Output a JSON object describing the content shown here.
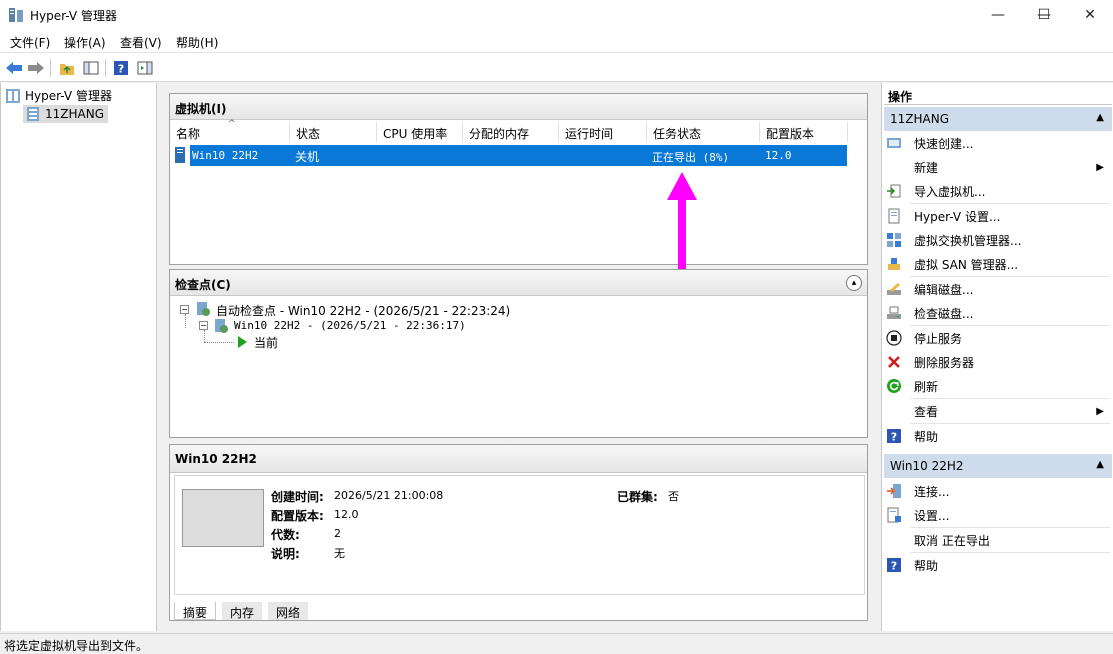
{
  "window": {
    "title": "Hyper-V 管理器",
    "controls": {
      "minimize": "—",
      "maximize": "☐",
      "close": "✕"
    }
  },
  "menu": [
    "文件(F)",
    "操作(A)",
    "查看(V)",
    "帮助(H)"
  ],
  "tree": {
    "root": "Hyper-V 管理器",
    "server": "11ZHANG"
  },
  "vms_panel": {
    "title": "虚拟机(I)",
    "columns": [
      "名称",
      "状态",
      "CPU 使用率",
      "分配的内存",
      "运行时间",
      "任务状态",
      "配置版本"
    ],
    "rows": [
      {
        "name": "Win10 22H2",
        "state": "关机",
        "cpu": "",
        "memory": "",
        "uptime": "",
        "task_status": "正在导出 (8%)",
        "version": "12.0"
      }
    ]
  },
  "checkpoints_panel": {
    "title": "检查点(C)",
    "items": [
      {
        "text": "自动检查点 - Win10 22H2 - (2026/5/21 - 22:23:24)"
      },
      {
        "text": "Win10 22H2 - (2026/5/21 - 22:36:17)"
      },
      {
        "text": "当前"
      }
    ]
  },
  "details_panel": {
    "title": "Win10 22H2",
    "fields": {
      "created_label": "创建时间:",
      "created_value": "2026/5/21 21:00:08",
      "version_label": "配置版本:",
      "version_value": "12.0",
      "generation_label": "代数:",
      "generation_value": "2",
      "notes_label": "说明:",
      "notes_value": "无",
      "clustered_label": "已群集:",
      "clustered_value": "否"
    },
    "tabs": [
      "摘要",
      "内存",
      "网络"
    ]
  },
  "actions": {
    "title": "操作",
    "server_section": "11ZHANG",
    "server_items": [
      "快速创建...",
      "新建",
      "导入虚拟机...",
      "Hyper-V 设置...",
      "虚拟交换机管理器...",
      "虚拟 SAN 管理器...",
      "编辑磁盘...",
      "检查磁盘...",
      "停止服务",
      "删除服务器",
      "刷新",
      "查看",
      "帮助"
    ],
    "vm_section": "Win10 22H2",
    "vm_items": [
      "连接...",
      "设置...",
      "取消 正在导出",
      "帮助"
    ]
  },
  "status": "将选定虚拟机导出到文件。",
  "colors": {
    "selection": "#0a78d7",
    "annotation_arrow": "#ff00ff",
    "section_header": "#cfdcec"
  }
}
